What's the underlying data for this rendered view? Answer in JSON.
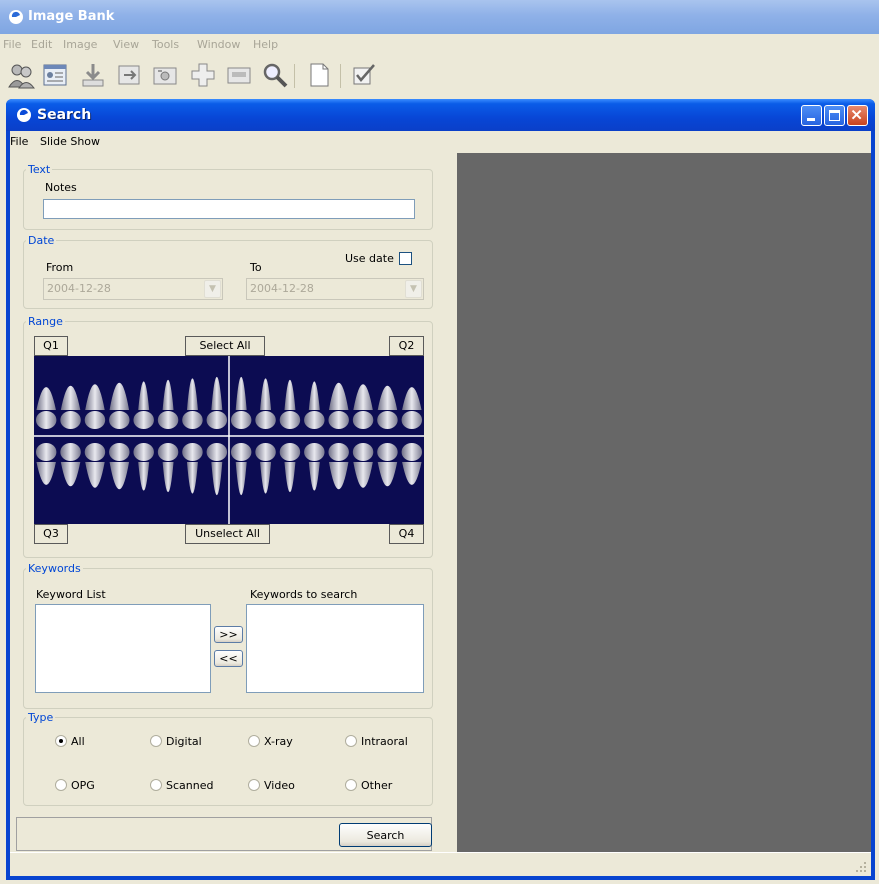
{
  "app": {
    "title": "Image Bank",
    "menu": [
      "File",
      "Edit",
      "Image",
      "View",
      "Tools",
      "Window",
      "Help"
    ],
    "toolbar_icons": [
      "patients-icon",
      "patient-card-icon",
      "import-icon",
      "export-icon",
      "camera-icon",
      "add-icon",
      "scanner-icon",
      "search-icon",
      "new-document-icon",
      "checklist-icon"
    ]
  },
  "search_window": {
    "title": "Search",
    "menu": [
      "File",
      "Slide Show"
    ],
    "text_group": {
      "legend": "Text",
      "notes_label": "Notes",
      "notes_value": ""
    },
    "date_group": {
      "legend": "Date",
      "from_label": "From",
      "to_label": "To",
      "use_date_label": "Use date",
      "use_date_checked": false,
      "from_value": "2004-12-28",
      "to_value": "2004-12-28"
    },
    "range_group": {
      "legend": "Range",
      "q1": "Q1",
      "q2": "Q2",
      "q3": "Q3",
      "q4": "Q4",
      "select_all": "Select All",
      "unselect_all": "Unselect All"
    },
    "keywords_group": {
      "legend": "Keywords",
      "list_label": "Keyword List",
      "search_label": "Keywords to search",
      "add_label": ">>",
      "remove_label": "<<"
    },
    "type_group": {
      "legend": "Type",
      "selected": "All",
      "options": [
        "All",
        "Digital",
        "X-ray",
        "Intraoral",
        "OPG",
        "Scanned",
        "Video",
        "Other"
      ]
    },
    "search_button": "Search"
  },
  "colors": {
    "active_titlebar": "#0846d6",
    "inactive_titlebar": "#8fb1e8",
    "group_legend": "#0046d5",
    "preview_background": "#676767",
    "teeth_background": "#0c0c52"
  }
}
